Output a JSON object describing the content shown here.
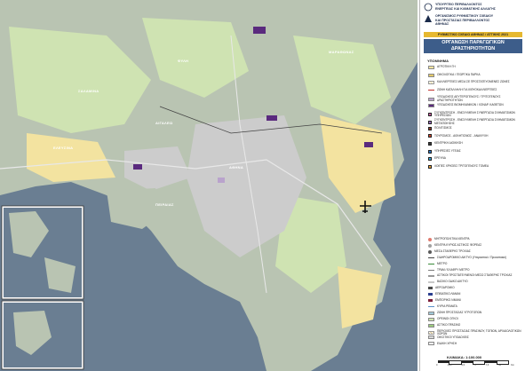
{
  "header": {
    "ministry_line1": "ΥΠΟΥΡΓΕΙΟ ΠΕΡΙΒΑΛΛΟΝΤΟΣ",
    "ministry_line2": "ΕΝΕΡΓΕΙΑΣ ΚΑΙ ΚΛΙΜΑΤΙΚΗΣ ΑΛΛΑΓΗΣ",
    "org_line1": "ΟΡΓΑΝΙΣΜΟΣ ΡΥΘΜΙΣΤΙΚΟΥ ΣΧΕΔΙΟΥ",
    "org_line2": "ΚΑΙ ΠΡΟΣΤΑΣΙΑΣ ΠΕΡΙΒΑΛΛΟΝΤΟΣ",
    "org_line3": "ΑΘΗΝΑΣ",
    "plan_title": "ΡΥΘΜΙΣΤΙΚΟ ΣΧΕΔΙΟ ΑΘΗΝΑΣ / ΑΤΤΙΚΗΣ 2021",
    "map_title_line1": "ΟΡΓΑΝΩΣΗ ΠΑΡΑΓΩΓΙΚΩΝ",
    "map_title_line2": "ΔΡΑΣΤΗΡΙΟΤΗΤΩΝ"
  },
  "legend": {
    "heading": "ΥΠΟΜΝΗΜΑ",
    "items": [
      {
        "label": "ΑΓΡΟΤΙΚΗ ΓΗ",
        "color": "#f3e3a0",
        "kind": "fill"
      },
      {
        "label": "ΟΙΚΟΛΟΓΙΚΑ / ΓΕΩΡΓΙΚΑ ΠΑΡΚΑ",
        "color": "#e2c96a",
        "kind": "fill"
      },
      {
        "label": "ΚΑΛΛΙΕΡΓΕΙΕΣ ΜΕΣΑ ΣΕ ΠΡΟΣΤΑΤΕΥΟΜΕΝΕΣ ΖΩΝΕΣ",
        "color": "#f0dfa8",
        "kind": "hatch"
      },
      {
        "label": "ΖΩΝΗ ΚΑΤΑΛΛΗΛΗ ΓΙΑ ΙΧΘΥΟΚΑΛΛΙΕΡΓΕΙΕΣ",
        "color": "#c0302a",
        "kind": "line"
      },
      {
        "label": "ΥΠΟΔΟΧΕΙΣ ΔΕΥΤΕΡΟΓΕΝΟΥΣ / ΤΡΙΤΟΓΕΝΟΥΣ ΔΡΑΣΤΗΡΙΟΤΗΤΩΝ",
        "color": "#b9a3cc",
        "kind": "fill"
      },
      {
        "label": "ΥΠΟΔΟΧΕΙΣ ΒΙΟΜΗΧΑΝΙΚΩΝ / ΧΟΝΔΡ. ΚΑΘΕΤΩΝ",
        "color": "#5a2a7e",
        "kind": "fill"
      },
      {
        "label": "ΣΥΓΚΕΝΤΡΩΣΗ - ΕΝΙΣΧΥΜΕΝΗ ΣΥΝΕΡΓΑΣΙΑ ΣΧΗΜΑΤΙΣΜΩΝ ΥΠΗΡΕΣΙΩΝ",
        "color": "#cc5fa6",
        "kind": "box"
      },
      {
        "label": "ΣΥΓΚΕΝΤΡΩΣΗ - ΕΝΙΣΧΥΜΕΝΗ ΣΥΝΕΡΓΑΣΙΑ ΣΧΗΜΑΤΙΣΜΩΝ ΜΕΤΑΠΟΙΗΣΗΣ",
        "color": "#9b6fc2",
        "kind": "box"
      },
      {
        "label": "ΠΟΛΙΤΙΣΜΟΣ",
        "color": "#8a3b2a",
        "kind": "box"
      },
      {
        "label": "ΤΟΥΡΙΣΜΟΣ - ΑΘΛΗΤΙΣΜΟΣ - ΑΝΑΨΥΧΗ",
        "color": "#d2452b",
        "kind": "box"
      },
      {
        "label": "ΚΕΝΤΡΙΚΗ ΔΙΟΙΚΗΣΗ",
        "color": "#3b3b3b",
        "kind": "box"
      },
      {
        "label": "ΥΠΗΡΕΣΙΕΣ ΥΓΕΙΑΣ",
        "color": "#2e78c7",
        "kind": "box"
      },
      {
        "label": "ΕΡΕΥΝΑ",
        "color": "#3aa6d6",
        "kind": "box"
      },
      {
        "label": "ΛΟΙΠΕΣ ΧΡΗΣΕΙΣ ΤΡΙΤΟΓΕΝΟΥΣ ΤΟΜΕΑ",
        "color": "#e8a13a",
        "kind": "box"
      }
    ],
    "items2": [
      {
        "label": "ΜΗΤΡΟΠΟΛΙΤΙΚΑ ΚΕΝΤΡΑ",
        "color": "#e07a6e",
        "kind": "circle"
      },
      {
        "label": "ΚΕΝΤΡΑ ΚΥΡΙΩΣ ΑΣΤΙΚΟΣ ΦΟΡΕΑΣ",
        "color": "#a0a0a0",
        "kind": "dot"
      },
      {
        "label": "ΜΕΣΑ ΣΤΑΘΕΡΗΣ ΤΡΟΧΙΑΣ",
        "color": "#5a5a5a",
        "kind": "dot"
      },
      {
        "label": "ΣΙΔΗΡΟΔΡΟΜΙΚΟ ΔΙΚΤΥΟ (Υπεραστικό / Προαστιακό)",
        "color": "#444444",
        "kind": "line"
      },
      {
        "label": "ΜΕΤΡΟ",
        "color": "#3a8a3a",
        "kind": "line"
      },
      {
        "label": "ΤΡΑΜ / ΕΛΑΦΡΥ ΜΕΤΡΟ",
        "color": "#7a7a7a",
        "kind": "line"
      },
      {
        "label": "ΑΣΤΙΚΟΙ ΠΡΟΣΤΑΤΕΥΜΕΝΟΙ ΜΕΣΩ ΣΤΑΘΕΡΗΣ ΤΡΟΧΙΑΣ",
        "color": "#999999",
        "kind": "line"
      },
      {
        "label": "ΒΑΣΙΚΟ ΟΔΙΚΟ ΔΙΚΤΥΟ",
        "color": "#c8c8c8",
        "kind": "line"
      },
      {
        "label": "ΑΕΡΟΔΡΟΜΙΟ",
        "color": "#4a4a4a",
        "kind": "plane"
      },
      {
        "label": "ΕΠΙΒΑΤΙΚΟ ΛΙΜΑΝΙ",
        "color": "#2b3f8f",
        "kind": "ship"
      },
      {
        "label": "ΕΜΠΟΡΙΚΟ ΛΙΜΑΝΙ",
        "color": "#7d1f3a",
        "kind": "ship"
      },
      {
        "label": "ΚΥΡΙΑ ΡΕΜΑΤΑ",
        "color": "#5a8fc7",
        "kind": "line"
      },
      {
        "label": "ΖΩΝΗ ΠΡΟΣΤΑΣΙΑΣ ΥΓΡΟΤΟΠΩΝ",
        "color": "#9fc8d8",
        "kind": "fill"
      },
      {
        "label": "ΟΡΕΙΝΟΙ ΟΓΚΟΙ",
        "color": "#cfe3b2",
        "kind": "fill"
      },
      {
        "label": "ΑΣΤΙΚΟ ΠΡΑΣΙΝΟ",
        "color": "#9ccc7e",
        "kind": "fill"
      },
      {
        "label": "ΠΕΡΙΟΧΕΣ ΠΡΟΣΤΑΣΙΑΣ ΠΡΑΣΙΝΟΥ, ΤΟΠΙΩΝ, ΑΡΧΑΙΟΛΟΓΙΚΩΝ ΧΩΡΩΝ",
        "color": "#d8c28a",
        "kind": "hatch"
      },
      {
        "label": "ΟΙΚΙΣΤΙΚΟΙ ΥΠΟΔΟΧΕΙΣ",
        "color": "#d8d8d8",
        "kind": "fill"
      },
      {
        "label": "ΕΙΔΙΚΗ ΧΡΗΣΗ",
        "color": "#eeeeee",
        "kind": "fill"
      }
    ]
  },
  "scale": {
    "label": "ΚΛΙΜΑΚΑ: 1:100.000",
    "ticks": [
      "0",
      "1,25",
      "2,5",
      "5",
      "7,5",
      "10",
      "Km"
    ]
  },
  "map_labels": [
    {
      "text": "ΣΑΛΑΜΙΝΑ"
    },
    {
      "text": "ΠΕΙΡΑΙΑΣ"
    },
    {
      "text": "ΑΘΗΝΑ"
    },
    {
      "text": "ΕΛΕΥΣΙΝΑ"
    },
    {
      "text": "ΦΥΛΗ"
    },
    {
      "text": "ΑΙΓΑΛΕΩ"
    },
    {
      "text": "ΜΑΡΑΘΩΝΑΣ"
    }
  ],
  "colors": {
    "sea": "#6a7e92",
    "land": "#b9c4b2",
    "mountain": "#cfe3b2",
    "urban": "#cccccc",
    "agri": "#f3e3a0",
    "industry": "#5a2a7e",
    "title_bar": "#3d5d8a",
    "plan_bar": "#e6b830"
  }
}
